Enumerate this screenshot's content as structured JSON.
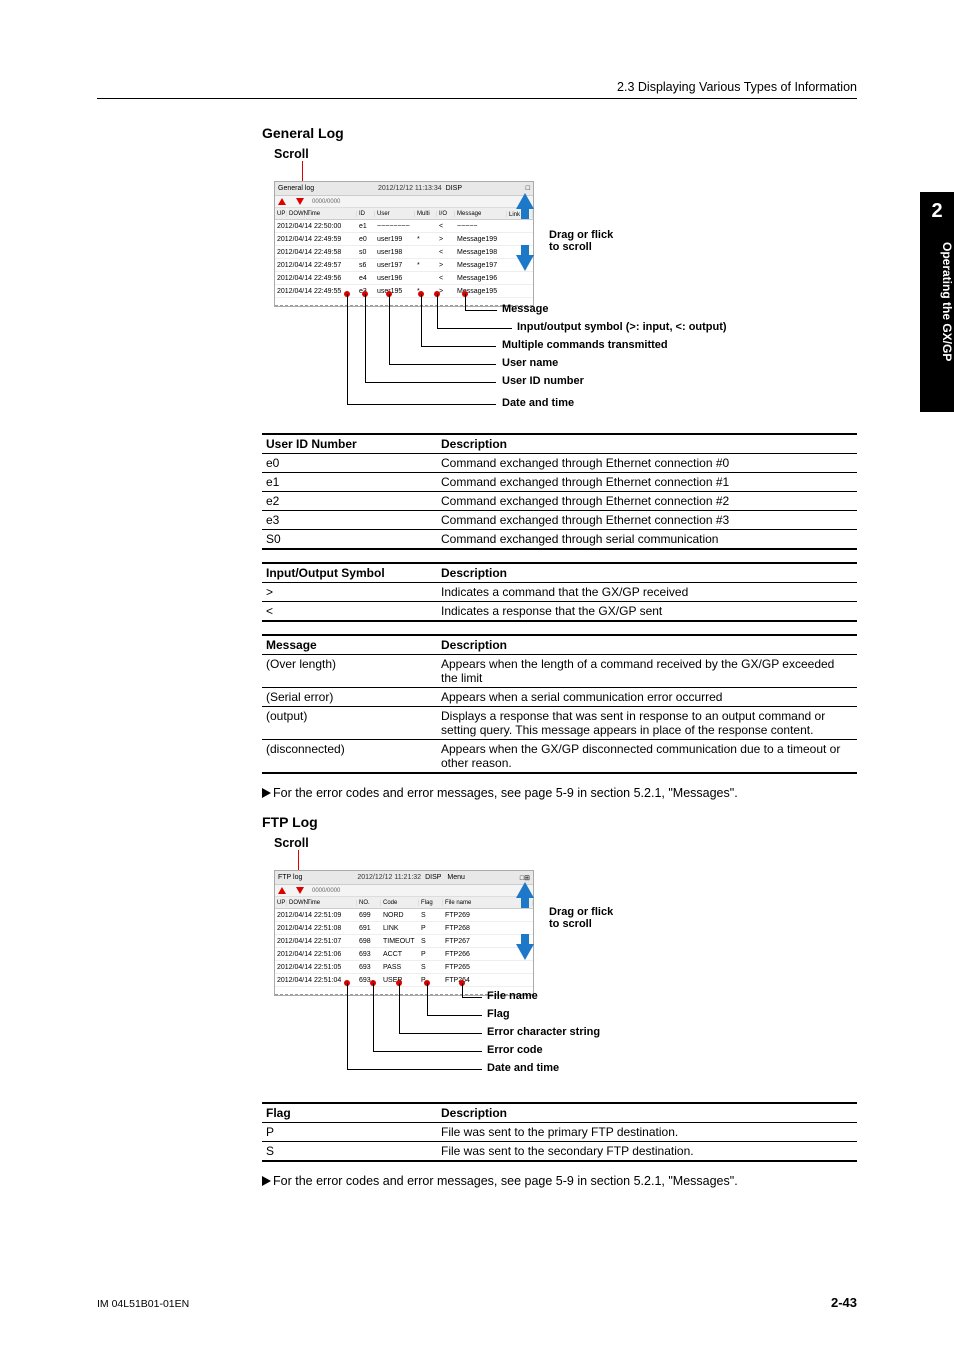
{
  "header": {
    "breadcrumb": "2.3  Displaying Various Types of Information"
  },
  "sidebar": {
    "chapter": "2",
    "title": "Operating the GX/GP"
  },
  "sections": {
    "general": {
      "title": "General Log",
      "scroll_label": "Scroll",
      "drag_label_1": "Drag or flick",
      "drag_label_2": "to scroll",
      "win_title": "General log",
      "win_datetime": "2012/12/12 11:13:34",
      "badge": "DISP",
      "count_tiny": "0000/0000",
      "up": "UP",
      "down": "DOWN",
      "time": "Time",
      "cols": {
        "id": "ID",
        "user": "User",
        "multi": "Multi",
        "io": "I/O",
        "msg": "Message",
        "link": "Link"
      },
      "rows": [
        {
          "dt": "2012/04/14 22:50:00",
          "id": "e1",
          "user": "~~~~~~~~",
          "multi": "",
          "io": "<",
          "msg": "~~~~~"
        },
        {
          "dt": "2012/04/14 22:49:59",
          "id": "e0",
          "user": "user199",
          "multi": "*",
          "io": ">",
          "msg": "Message199"
        },
        {
          "dt": "2012/04/14 22:49:58",
          "id": "s0",
          "user": "user198",
          "multi": "",
          "io": "<",
          "msg": "Message198"
        },
        {
          "dt": "2012/04/14 22:49:57",
          "id": "s6",
          "user": "user197",
          "multi": "*",
          "io": ">",
          "msg": "Message197"
        },
        {
          "dt": "2012/04/14 22:49:56",
          "id": "e4",
          "user": "user196",
          "multi": "",
          "io": "<",
          "msg": "Message196"
        },
        {
          "dt": "2012/04/14 22:49:55",
          "id": "e3",
          "user": "user195",
          "multi": "*",
          "io": ">",
          "msg": "Message195"
        }
      ],
      "callouts": {
        "message": "Message",
        "io": "Input/output symbol (>: input, <: output)",
        "multi": "Multiple commands transmitted",
        "user": "User name",
        "uid": "User ID number",
        "dt": "Date and time"
      }
    },
    "ftp": {
      "title": "FTP Log",
      "scroll_label": "Scroll",
      "drag_label_1": "Drag or flick",
      "drag_label_2": "to scroll",
      "win_title": "FTP log",
      "win_datetime": "2012/12/12 11:21:32",
      "badge": "DISP",
      "menu": "Menu",
      "count_tiny": "0000/0000",
      "up": "UP",
      "down": "DOWN",
      "time": "Time",
      "cols": {
        "no": "NO.",
        "code": "Code",
        "flag": "Flag",
        "file": "File name"
      },
      "rows": [
        {
          "dt": "2012/04/14 22:51:09",
          "no": "699",
          "code": "NORD",
          "flag": "S",
          "file": "FTP269"
        },
        {
          "dt": "2012/04/14 22:51:08",
          "no": "691",
          "code": "LINK",
          "flag": "P",
          "file": "FTP268"
        },
        {
          "dt": "2012/04/14 22:51:07",
          "no": "698",
          "code": "TIMEOUT",
          "flag": "S",
          "file": "FTP267"
        },
        {
          "dt": "2012/04/14 22:51:06",
          "no": "693",
          "code": "ACCT",
          "flag": "P",
          "file": "FTP266"
        },
        {
          "dt": "2012/04/14 22:51:05",
          "no": "693",
          "code": "PASS",
          "flag": "S",
          "file": "FTP265"
        },
        {
          "dt": "2012/04/14 22:51:04",
          "no": "693",
          "code": "USER",
          "flag": "P",
          "file": "FTP264"
        }
      ],
      "callouts": {
        "file": "File name",
        "flag": "Flag",
        "errstr": "Error character string",
        "errcode": "Error code",
        "dt": "Date and time"
      }
    }
  },
  "tables": {
    "uid": {
      "h1": "User ID Number",
      "h2": "Description",
      "rows": [
        [
          "e0",
          "Command exchanged through Ethernet connection #0"
        ],
        [
          "e1",
          "Command exchanged through Ethernet connection #1"
        ],
        [
          "e2",
          "Command exchanged through Ethernet connection #2"
        ],
        [
          "e3",
          "Command exchanged through Ethernet connection #3"
        ],
        [
          "S0",
          "Command exchanged through serial communication"
        ]
      ]
    },
    "io": {
      "h1": "Input/Output Symbol",
      "h2": "Description",
      "rows": [
        [
          ">",
          "Indicates a command that the GX/GP received"
        ],
        [
          "<",
          "Indicates a response that the GX/GP sent"
        ]
      ]
    },
    "msg": {
      "h1": "Message",
      "h2": "Description",
      "rows": [
        [
          "(Over length)",
          "Appears when the length of a command received by the GX/GP exceeded the limit"
        ],
        [
          "(Serial error)",
          "Appears when a serial communication error occurred"
        ],
        [
          "(output)",
          "Displays a response that was sent in response to an output command or setting query. This message appears in place of the response content."
        ],
        [
          "(disconnected)",
          "Appears when the GX/GP disconnected communication due to a timeout or other reason."
        ]
      ]
    },
    "flag": {
      "h1": "Flag",
      "h2": "Description",
      "rows": [
        [
          "P",
          "File was sent to the primary FTP destination."
        ],
        [
          "S",
          "File was sent to the secondary FTP destination."
        ]
      ]
    }
  },
  "notes": {
    "xref": "For the error codes and error messages, see page 5-9 in section 5.2.1, \"Messages\"."
  },
  "footer": {
    "left": "IM 04L51B01-01EN",
    "right": "2-43"
  }
}
